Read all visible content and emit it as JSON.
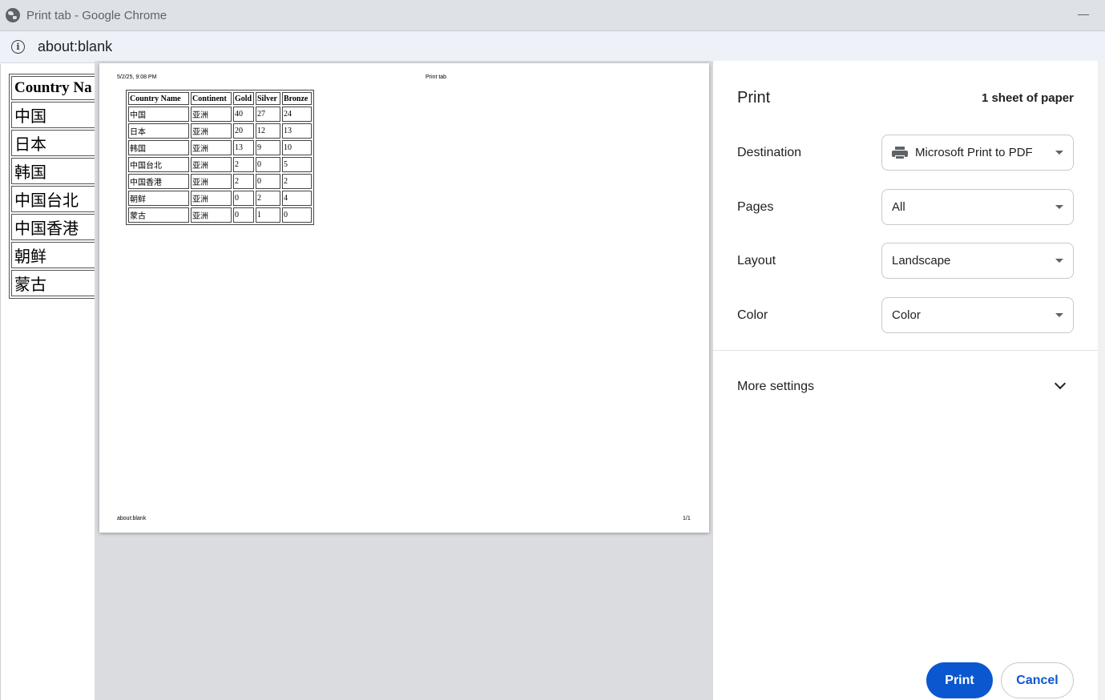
{
  "window": {
    "title": "Print tab - Google Chrome"
  },
  "address": {
    "url": "about:blank"
  },
  "background_table": {
    "header": "Country Na",
    "rows": [
      "中国",
      "日本",
      "韩国",
      "中国台北",
      "中国香港",
      "朝鲜",
      "蒙古"
    ]
  },
  "preview": {
    "header_date": "5/2/25, 9:08 PM",
    "header_title": "Print tab",
    "footer_url": "about:blank",
    "footer_page": "1/1",
    "table": {
      "columns": [
        "Country Name",
        "Continent",
        "Gold",
        "Silver",
        "Bronze"
      ],
      "rows": [
        [
          "中国",
          "亚洲",
          "40",
          "27",
          "24"
        ],
        [
          "日本",
          "亚洲",
          "20",
          "12",
          "13"
        ],
        [
          "韩国",
          "亚洲",
          "13",
          "9",
          "10"
        ],
        [
          "中国台北",
          "亚洲",
          "2",
          "0",
          "5"
        ],
        [
          "中国香港",
          "亚洲",
          "2",
          "0",
          "2"
        ],
        [
          "朝鲜",
          "亚洲",
          "0",
          "2",
          "4"
        ],
        [
          "蒙古",
          "亚洲",
          "0",
          "1",
          "0"
        ]
      ]
    }
  },
  "print_panel": {
    "heading": "Print",
    "sheet_count": "1 sheet of paper",
    "destination_label": "Destination",
    "destination_value": "Microsoft Print to PDF",
    "pages_label": "Pages",
    "pages_value": "All",
    "layout_label": "Layout",
    "layout_value": "Landscape",
    "color_label": "Color",
    "color_value": "Color",
    "more_settings": "More settings",
    "print_button": "Print",
    "cancel_button": "Cancel"
  },
  "colors": {
    "accent": "#0b57d0",
    "preview_bg": "#dadce0",
    "titlebar": "#dee1e6"
  }
}
